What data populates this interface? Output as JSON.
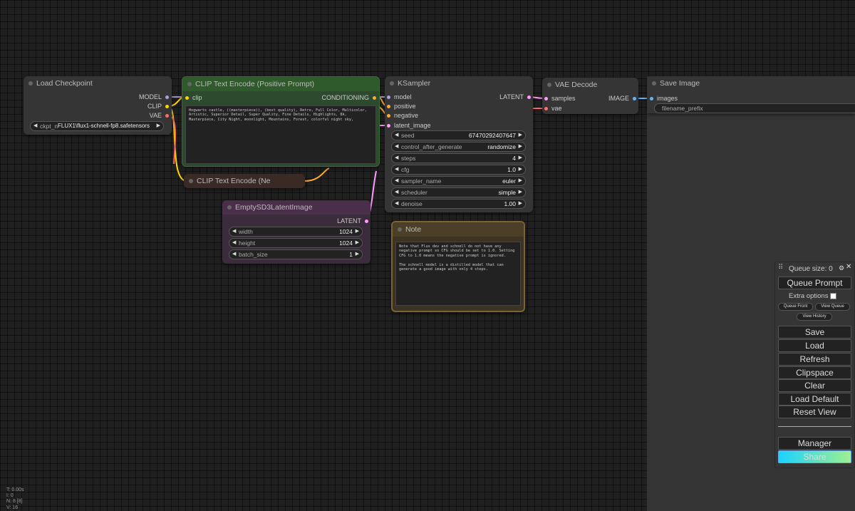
{
  "colors": {
    "canvas_bg": "#202020",
    "node_bg": "#353535",
    "clip_positive_bg": "#2e4a2e",
    "clip_positive_border": "#3d6b37",
    "clip_negative_bg": "#3a2a25",
    "latent_node_bg": "#3a2c3a",
    "note_bg": "#3c3323",
    "note_border": "#7a6436",
    "wire_model": "#b39ddb",
    "wire_clip": "#ffd500",
    "wire_vae": "#ff6e6e",
    "wire_conditioning": "#ffa931",
    "wire_latent": "#ff9cf9",
    "wire_image": "#64b5f6",
    "share_gradient_start": "#1ad3ff",
    "share_gradient_end": "#9ff08f"
  },
  "nodes": {
    "load_checkpoint": {
      "title": "Load Checkpoint",
      "outputs": [
        "MODEL",
        "CLIP",
        "VAE"
      ],
      "ckpt_label": "ckpt_n",
      "ckpt_value": "FLUX1\\flux1-schnell-fp8.safetensors"
    },
    "clip_positive": {
      "title": "CLIP Text Encode (Positive Prompt)",
      "input": "clip",
      "output": "CONDITIONING",
      "text": "Hogwarts castle, ((masterpiece)), (best quality), Retro, Full Color, Multicolor, Artistic, Superior Detail, Super Quality, Fine Details, Highlights, 8k, Masterpiece, City Night, moonlight, Mountains, Forest, colorful night sky,"
    },
    "clip_negative": {
      "title": "CLIP Text Encode (Ne"
    },
    "ksampler": {
      "title": "KSampler",
      "inputs": [
        "model",
        "positive",
        "negative",
        "latent_image"
      ],
      "output": "LATENT",
      "widgets": [
        {
          "label": "seed",
          "value": "67470292407647"
        },
        {
          "label": "control_after_generate",
          "value": "randomize"
        },
        {
          "label": "steps",
          "value": "4"
        },
        {
          "label": "cfg",
          "value": "1.0"
        },
        {
          "label": "sampler_name",
          "value": "euler"
        },
        {
          "label": "scheduler",
          "value": "simple"
        },
        {
          "label": "denoise",
          "value": "1.00"
        }
      ]
    },
    "vae_decode": {
      "title": "VAE Decode",
      "inputs": [
        "samples",
        "vae"
      ],
      "output": "IMAGE"
    },
    "save_image": {
      "title": "Save Image",
      "input": "images",
      "filename_prefix_label": "filename_prefix"
    },
    "empty_latent": {
      "title": "EmptySD3LatentImage",
      "output": "LATENT",
      "widgets": [
        {
          "label": "width",
          "value": "1024"
        },
        {
          "label": "height",
          "value": "1024"
        },
        {
          "label": "batch_size",
          "value": "1"
        }
      ]
    },
    "note": {
      "title": "Note",
      "text": "Note that Flux dev and schnell do not have any negative prompt so CFG should be set to 1.0. Setting CFG to 1.0 means the negative prompt is ignored.\n\nThe schnell model is a distilled model that can generate a good image with only 4 steps."
    }
  },
  "queue_panel": {
    "queue_size": "Queue size: 0",
    "queue_prompt": "Queue Prompt",
    "extra_options": "Extra options",
    "queue_front": "Queue Front",
    "view_queue": "View Queue",
    "view_history": "View History",
    "buttons": [
      "Save",
      "Load",
      "Refresh",
      "Clipspace",
      "Clear",
      "Load Default",
      "Reset View"
    ],
    "manager": "Manager",
    "share": "Share"
  },
  "stats": {
    "time": "T: 0.00s",
    "i": "I: 0",
    "n": "N: 8 [8]",
    "v": "V: 16"
  }
}
